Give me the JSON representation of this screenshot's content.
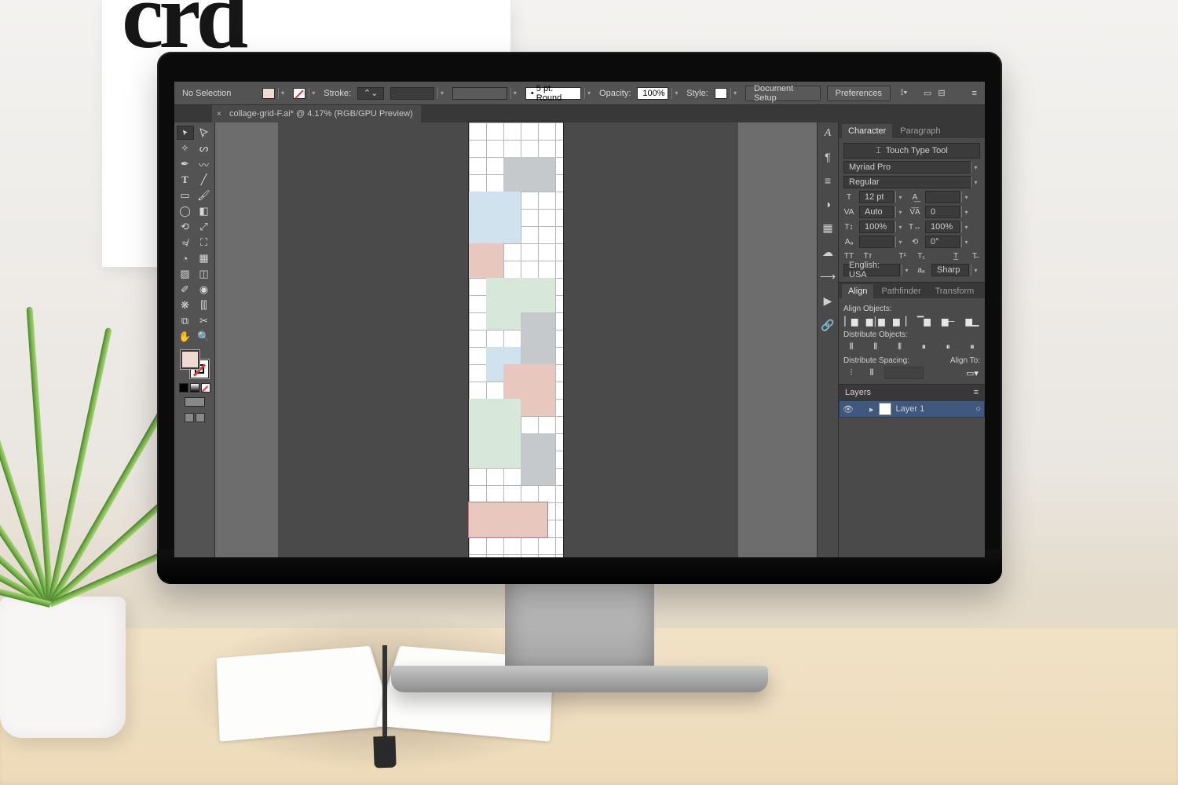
{
  "brand_logo": "crd",
  "options_bar": {
    "selection_status": "No Selection",
    "fill_color": "#efd9d0",
    "stroke_state": "none",
    "stroke_label": "Stroke:",
    "stroke_weight": "",
    "stroke_profile": "5 pt. Round",
    "opacity_label": "Opacity:",
    "opacity_value": "100%",
    "style_label": "Style:",
    "btn_doc_setup": "Document Setup",
    "btn_preferences": "Preferences"
  },
  "document_tab": "collage-grid-F.ai* @ 4.17% (RGB/GPU Preview)",
  "character_panel": {
    "tabs": [
      "Character",
      "Paragraph"
    ],
    "touch_tool": "Touch Type Tool",
    "font_family": "Myriad Pro",
    "font_style": "Regular",
    "font_size": "12 pt",
    "leading": "",
    "kerning": "Auto",
    "tracking": "0",
    "vscale": "100%",
    "hscale": "100%",
    "baseline": "",
    "rotation": "0°",
    "language": "English: USA",
    "antialias": "Sharp"
  },
  "align_panel": {
    "tabs": [
      "Align",
      "Pathfinder",
      "Transform"
    ],
    "align_objects_label": "Align Objects:",
    "distribute_objects_label": "Distribute Objects:",
    "distribute_spacing_label": "Distribute Spacing:",
    "align_to_label": "Align To:"
  },
  "layers_panel": {
    "title": "Layers",
    "layer_name": "Layer 1"
  },
  "colors": {
    "fill": "#efd9d0",
    "pink": "#e8c7bf",
    "blue": "#cfe2ee",
    "mint": "#d7e7da",
    "grey": "#c6c9cc"
  }
}
